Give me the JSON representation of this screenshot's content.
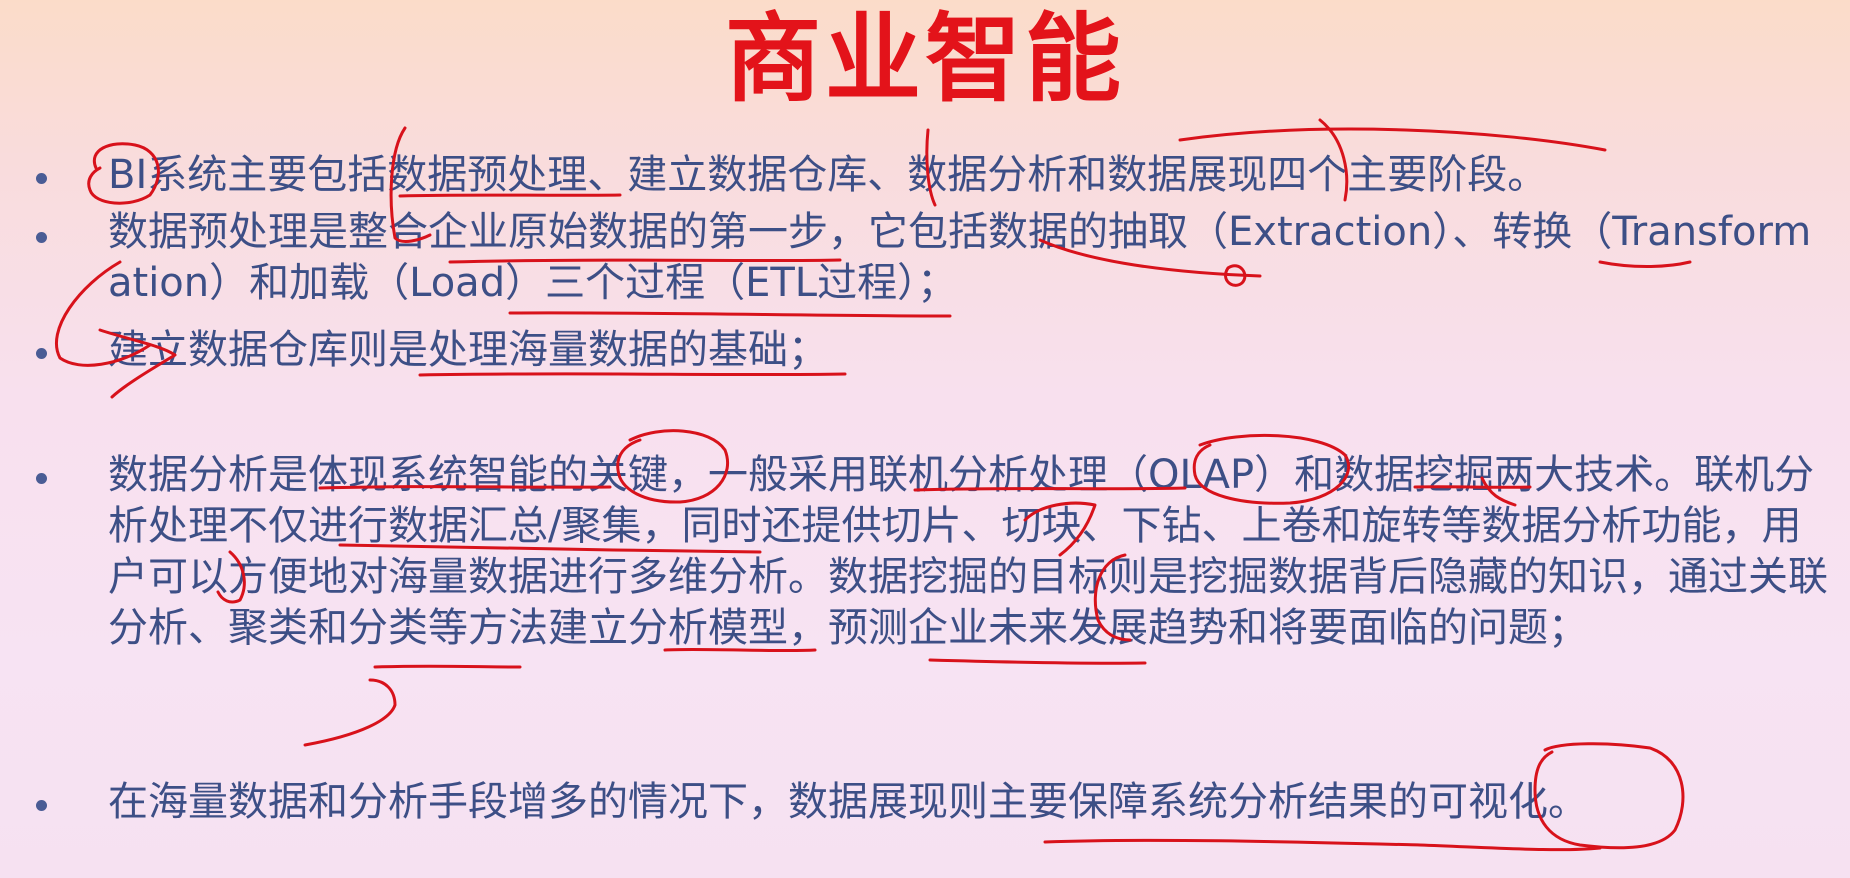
{
  "slide": {
    "title": "商业智能",
    "bullets": [
      "BI系统主要包括数据预处理、建立数据仓库、数据分析和数据展现四个主要阶段。",
      "数据预处理是整合企业原始数据的第一步，它包括数据的抽取（Extraction）、转换（Transformation）和加载（Load）三个过程（ETL过程）；",
      "建立数据仓库则是处理海量数据的基础；",
      "数据分析是体现系统智能的关键，一般采用联机分析处理（OLAP）和数据挖掘两大技术。联机分析处理不仅进行数据汇总/聚集，同时还提供切片、切块、下钻、上卷和旋转等数据分析功能，用户可以方便地对海量数据进行多维分析。数据挖掘的目标则是挖掘数据背后隐藏的知识，通过关联分析、聚类和分类等方法建立分析模型，预测企业未来发展趋势和将要面临的问题；",
      "在海量数据和分析手段增多的情况下，数据展现则主要保障系统分析结果的可视化。"
    ]
  },
  "colors": {
    "title": "#e3131a",
    "body_text": "#3d4f86",
    "annotation": "#d8121b",
    "background_top": "#fbdcc9",
    "background_bottom": "#f6e1f1"
  }
}
